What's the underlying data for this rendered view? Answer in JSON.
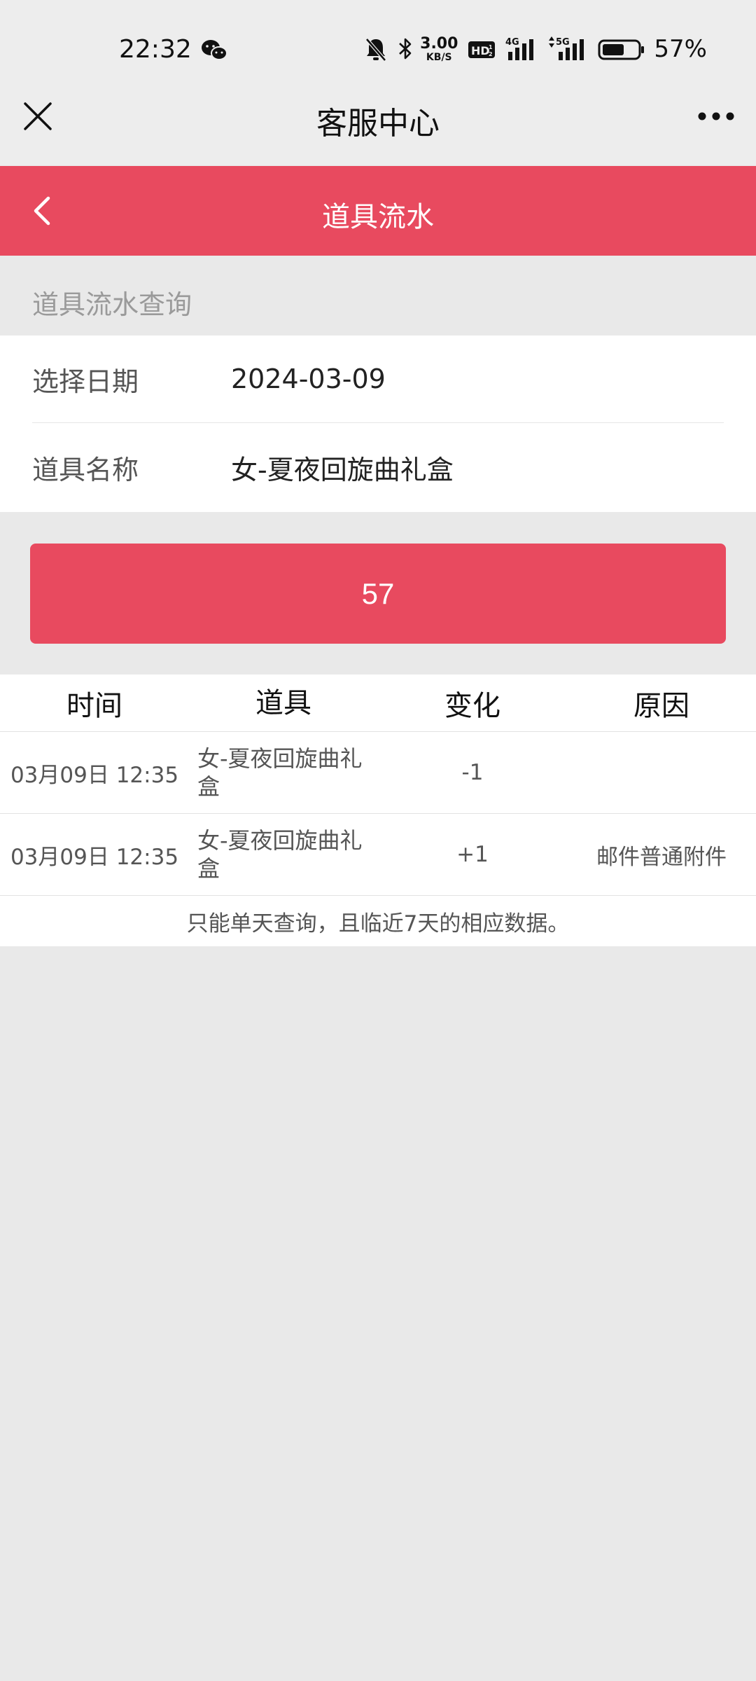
{
  "status_bar": {
    "time": "22:32",
    "left_icons": [
      "wechat-icon"
    ],
    "net_speed_value": "3.00",
    "net_speed_unit": "KB/S",
    "right_icons": [
      "bell-muted-icon",
      "bluetooth-icon",
      "hd-icon",
      "signal-4g-icon",
      "signal-5g-icon",
      "battery-icon"
    ],
    "battery_percent": "57%"
  },
  "title_bar": {
    "title": "客服中心",
    "close_icon": "close-icon",
    "more_icon": "more-icon"
  },
  "header": {
    "title": "道具流水",
    "back_icon": "chevron-left-icon",
    "color": "#e84a5f"
  },
  "query": {
    "caption": "道具流水查询",
    "date_label": "选择日期",
    "date_value": "2024-03-09",
    "item_label": "道具名称",
    "item_value": "女-夏夜回旋曲礼盒",
    "submit_label": "57"
  },
  "table": {
    "columns": [
      "时间",
      "道具",
      "变化",
      "原因"
    ],
    "rows": [
      {
        "time": "03月09日 12:35",
        "item": "女-夏夜回旋曲礼盒",
        "change": "-1",
        "reason": ""
      },
      {
        "time": "03月09日 12:35",
        "item": "女-夏夜回旋曲礼盒",
        "change": "+1",
        "reason": "邮件普通附件"
      }
    ],
    "note": "只能单天查询，且临近7天的相应数据。"
  },
  "colors": {
    "accent": "#e84a5f",
    "page_bg": "#e9e9e9",
    "title_bar_bg": "#ededed"
  }
}
